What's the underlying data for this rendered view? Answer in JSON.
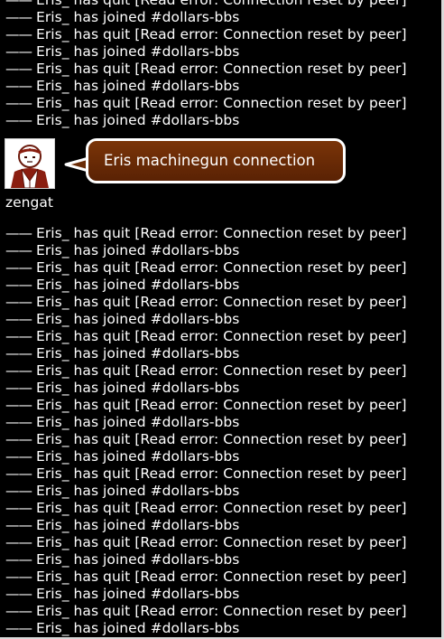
{
  "chat": {
    "before_lines": [
      {
        "dash": "——",
        "text": "Eris_ has quit [Read error: Connection reset by peer]"
      },
      {
        "dash": "——",
        "text": "Eris_ has joined #dollars-bbs"
      },
      {
        "dash": "——",
        "text": "Eris_ has quit [Read error: Connection reset by peer]"
      },
      {
        "dash": "——",
        "text": "Eris_ has joined #dollars-bbs"
      },
      {
        "dash": "——",
        "text": "Eris_ has quit [Read error: Connection reset by peer]"
      },
      {
        "dash": "——",
        "text": "Eris_ has joined #dollars-bbs"
      },
      {
        "dash": "——",
        "text": "Eris_ has quit [Read error: Connection reset by peer]"
      },
      {
        "dash": "——",
        "text": "Eris_ has joined #dollars-bbs"
      }
    ],
    "message": {
      "username": "zengat",
      "text": "Eris machinegun connection",
      "avatar_icon": "person-avatar-icon",
      "bubble_color": "#6b2c06"
    },
    "after_lines": [
      {
        "dash": "——",
        "text": "Eris_ has quit [Read error: Connection reset by peer]"
      },
      {
        "dash": "——",
        "text": "Eris_ has joined #dollars-bbs"
      },
      {
        "dash": "——",
        "text": "Eris_ has quit [Read error: Connection reset by peer]"
      },
      {
        "dash": "——",
        "text": "Eris_ has joined #dollars-bbs"
      },
      {
        "dash": "——",
        "text": "Eris_ has quit [Read error: Connection reset by peer]"
      },
      {
        "dash": "——",
        "text": "Eris_ has joined #dollars-bbs"
      },
      {
        "dash": "——",
        "text": "Eris_ has quit [Read error: Connection reset by peer]"
      },
      {
        "dash": "——",
        "text": "Eris_ has joined #dollars-bbs"
      },
      {
        "dash": "——",
        "text": "Eris_ has quit [Read error: Connection reset by peer]"
      },
      {
        "dash": "——",
        "text": "Eris_ has joined #dollars-bbs"
      },
      {
        "dash": "——",
        "text": "Eris_ has quit [Read error: Connection reset by peer]"
      },
      {
        "dash": "——",
        "text": "Eris_ has joined #dollars-bbs"
      },
      {
        "dash": "——",
        "text": "Eris_ has quit [Read error: Connection reset by peer]"
      },
      {
        "dash": "——",
        "text": "Eris_ has joined #dollars-bbs"
      },
      {
        "dash": "——",
        "text": "Eris_ has quit [Read error: Connection reset by peer]"
      },
      {
        "dash": "——",
        "text": "Eris_ has joined #dollars-bbs"
      },
      {
        "dash": "——",
        "text": "Eris_ has quit [Read error: Connection reset by peer]"
      },
      {
        "dash": "——",
        "text": "Eris_ has joined #dollars-bbs"
      },
      {
        "dash": "——",
        "text": "Eris_ has quit [Read error: Connection reset by peer]"
      },
      {
        "dash": "——",
        "text": "Eris_ has joined #dollars-bbs"
      },
      {
        "dash": "——",
        "text": "Eris_ has quit [Read error: Connection reset by peer]"
      },
      {
        "dash": "——",
        "text": "Eris_ has joined #dollars-bbs"
      },
      {
        "dash": "——",
        "text": "Eris_ has quit [Read error: Connection reset by peer]"
      },
      {
        "dash": "——",
        "text": "Eris_ has joined #dollars-bbs"
      }
    ]
  }
}
